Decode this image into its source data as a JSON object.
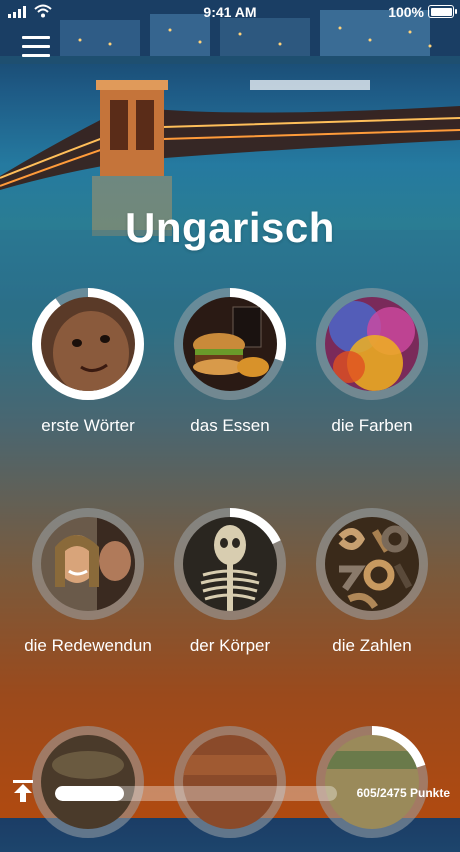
{
  "status_bar": {
    "time": "9:41 AM",
    "battery": "100%"
  },
  "title": "Ungarisch",
  "categories": [
    {
      "label": "erste Wörter",
      "progress": 0.9
    },
    {
      "label": "das Essen",
      "progress": 0.3
    },
    {
      "label": "die Farben",
      "progress": 0
    },
    {
      "label": "die Redewendun",
      "progress": 0
    },
    {
      "label": "der Körper",
      "progress": 0.18
    },
    {
      "label": "die Zahlen",
      "progress": 0
    },
    {
      "label": "",
      "progress": 0
    },
    {
      "label": "",
      "progress": 0
    },
    {
      "label": "",
      "progress": 0.2
    }
  ],
  "points": {
    "text": "605/2475 Punkte",
    "progress": 0.244
  },
  "colors": {
    "ring_track": "#9aa3a7",
    "ring_progress": "#ffffff"
  },
  "icons": {
    "menu": "hamburger-menu-icon",
    "upload": "upload-arrow-icon"
  }
}
